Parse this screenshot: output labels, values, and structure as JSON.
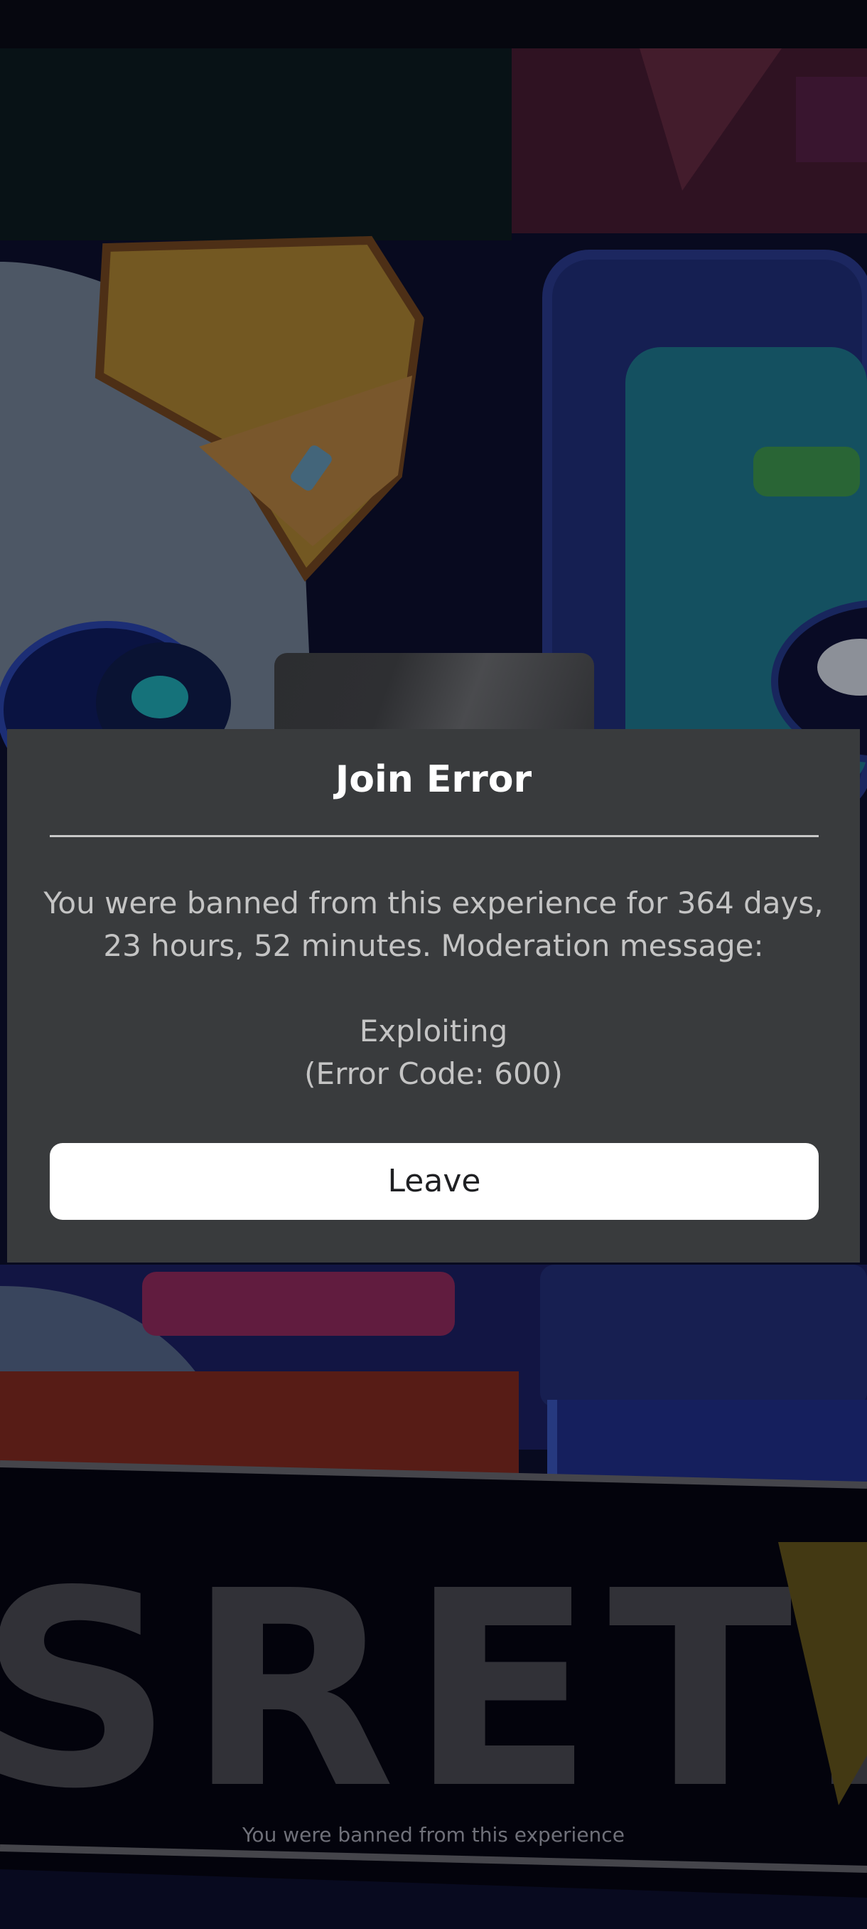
{
  "dialog": {
    "title": "Join Error",
    "message_line_1": "You were banned from this experience for 364 days,",
    "message_line_2": "23 hours, 52 minutes. Moderation message:",
    "moderation_reason": "Exploiting",
    "error_code": "(Error Code: 600)",
    "leave_label": "Leave"
  },
  "background": {
    "logo_text": "SRETE"
  },
  "footer": {
    "status_text": "You were banned from this experience"
  },
  "colors": {
    "dialog_background": "#393b3d",
    "button_background": "#ffffff",
    "divider": "#c8c8c8"
  }
}
